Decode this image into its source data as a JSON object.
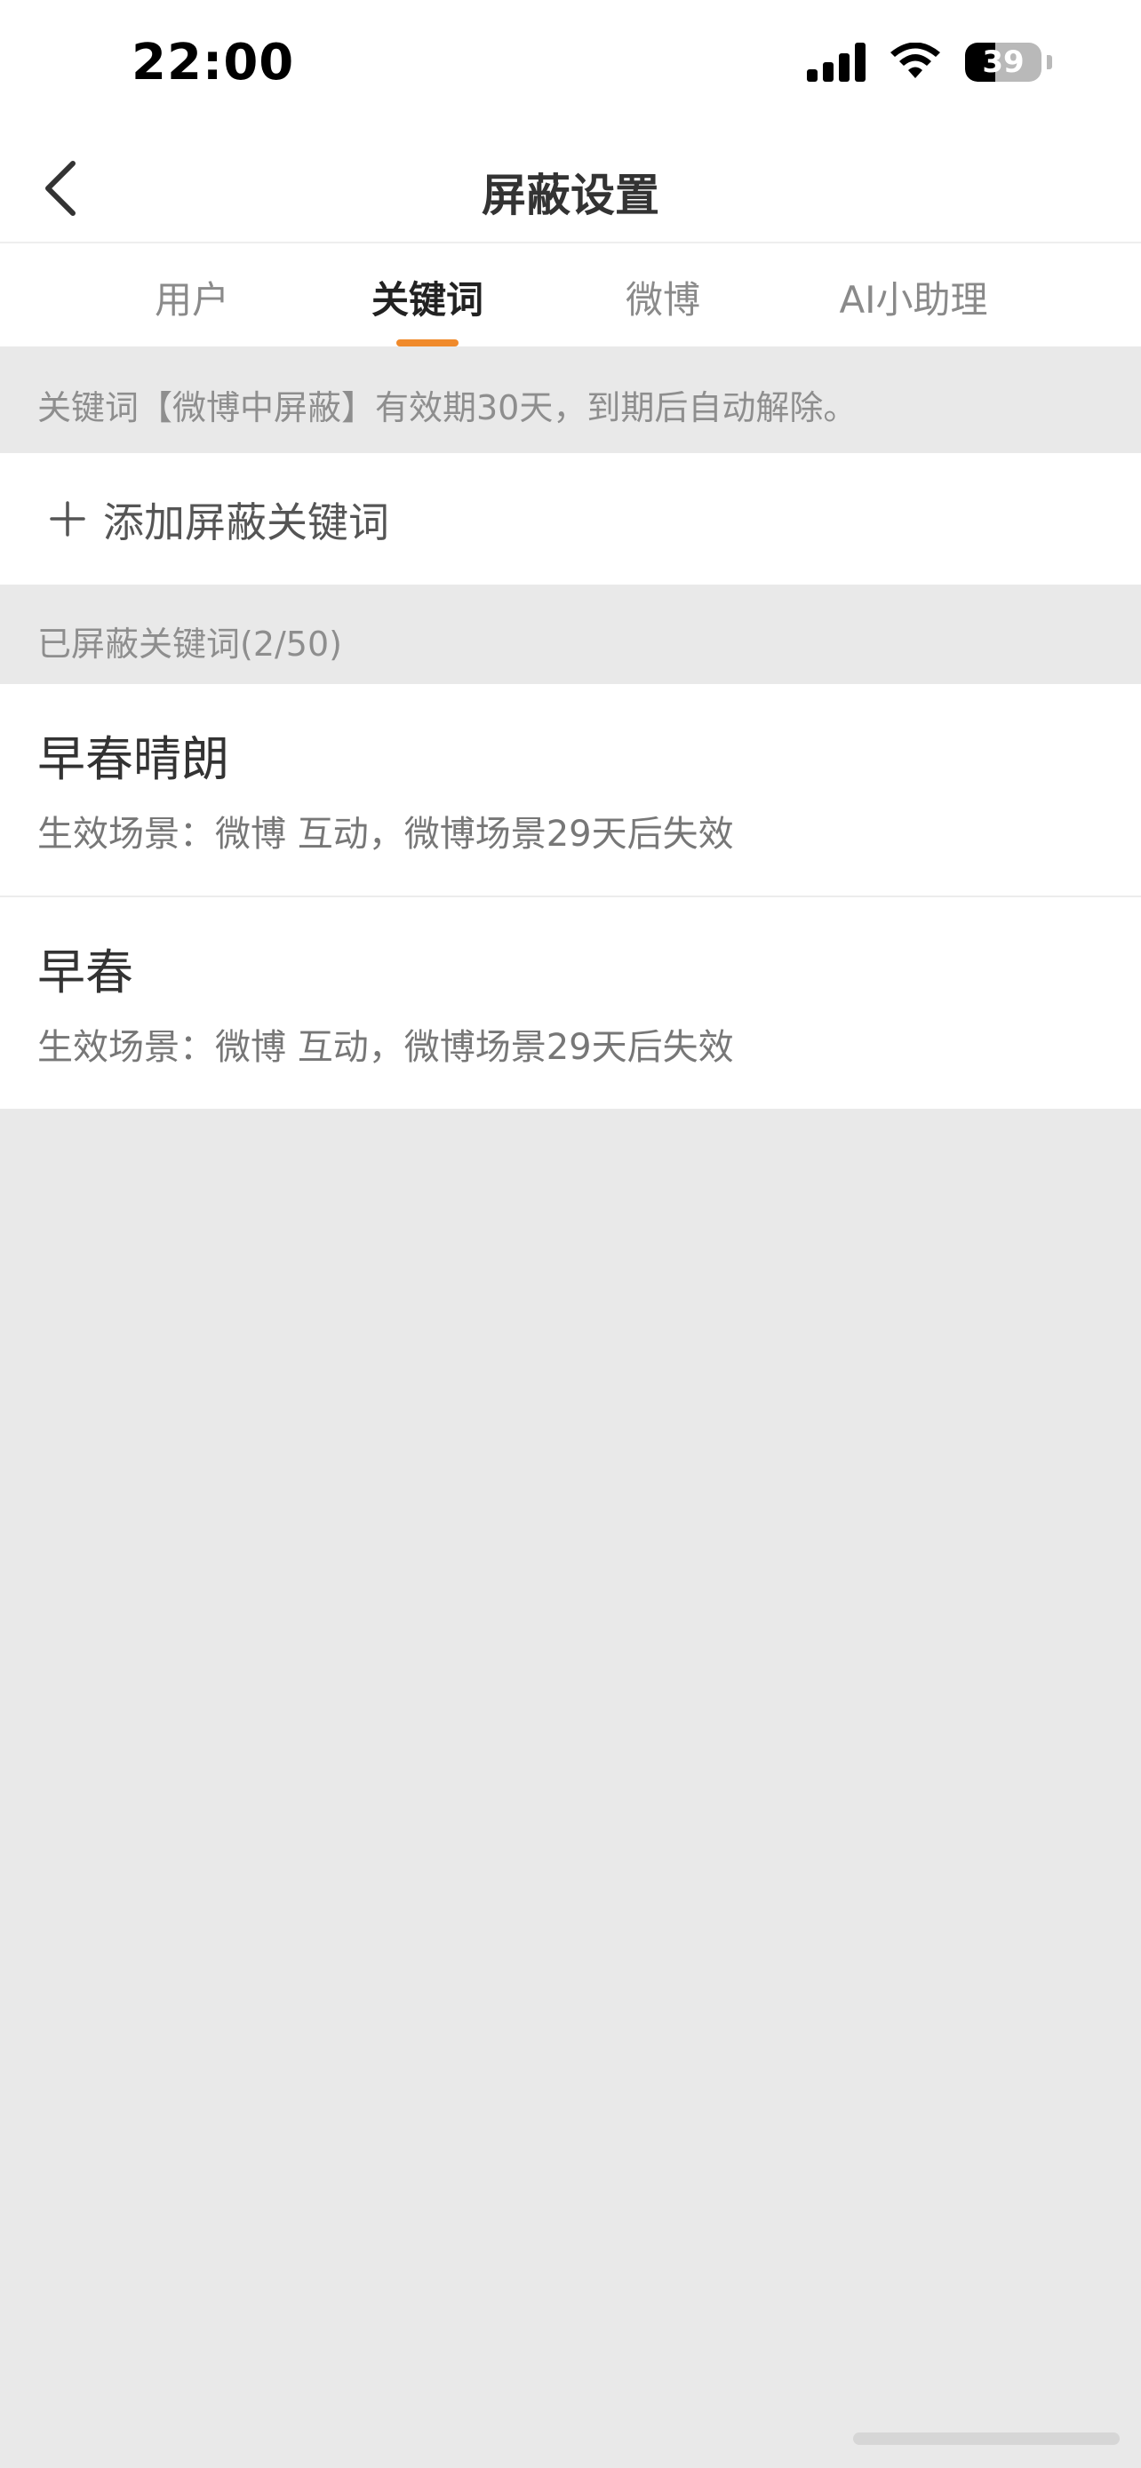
{
  "status_bar": {
    "time": "22:00",
    "battery": "39",
    "battery_level": 0.39
  },
  "nav": {
    "title": "屏蔽设置"
  },
  "tabs": [
    {
      "label": "用户",
      "active": false
    },
    {
      "label": "关键词",
      "active": true
    },
    {
      "label": "微博",
      "active": false
    },
    {
      "label": "AI小助理",
      "active": false
    }
  ],
  "notice": {
    "text": "关键词【微博中屏蔽】有效期30天，到期后自动解除。"
  },
  "add_keyword": {
    "label": "添加屏蔽关键词"
  },
  "blocked_section": {
    "title": "已屏蔽关键词(2/50)"
  },
  "keywords": [
    {
      "title": "早春晴朗",
      "subtitle": "生效场景：微博 互动，微博场景29天后失效"
    },
    {
      "title": "早春",
      "subtitle": "生效场景：微博 互动，微博场景29天后失效"
    }
  ],
  "colors": {
    "accent": "#f08a2b",
    "background": "#e9e9e9",
    "surface": "#ffffff"
  }
}
